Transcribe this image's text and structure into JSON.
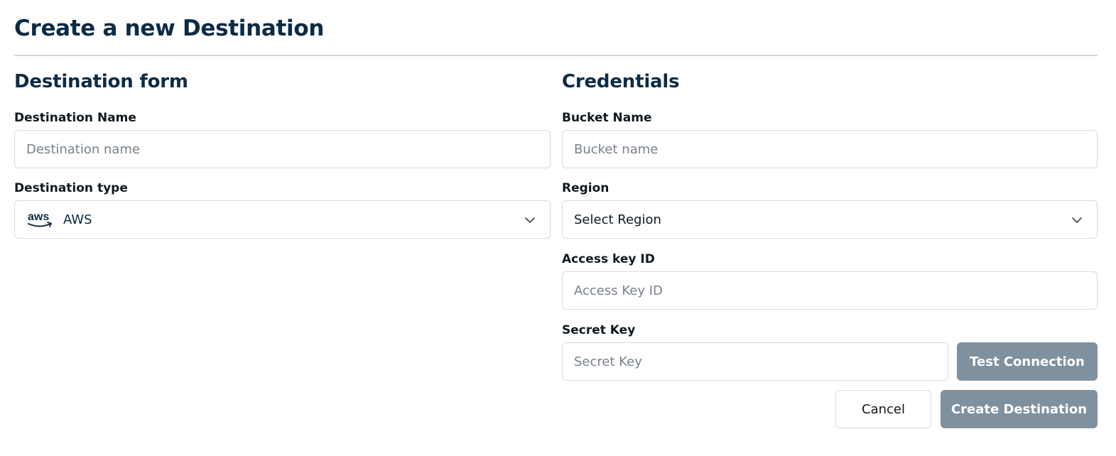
{
  "page": {
    "title": "Create a new Destination"
  },
  "left": {
    "section_title": "Destination form",
    "name_label": "Destination Name",
    "name_placeholder": "Destination name",
    "name_value": "",
    "type_label": "Destination type",
    "type_value": "AWS",
    "type_icon": "aws-logo-icon"
  },
  "right": {
    "section_title": "Credentials",
    "bucket_label": "Bucket Name",
    "bucket_placeholder": "Bucket name",
    "region_label": "Region",
    "region_value": "Select Region",
    "access_label": "Access key ID",
    "access_placeholder": "Access Key ID",
    "secret_label": "Secret Key",
    "secret_placeholder": "Secret Key"
  },
  "actions": {
    "test_connection": "Test Connection",
    "cancel": "Cancel",
    "create": "Create Destination"
  },
  "colors": {
    "heading": "#0c2b45",
    "disabled_button": "#7f919e",
    "border": "#d6dbe1"
  }
}
